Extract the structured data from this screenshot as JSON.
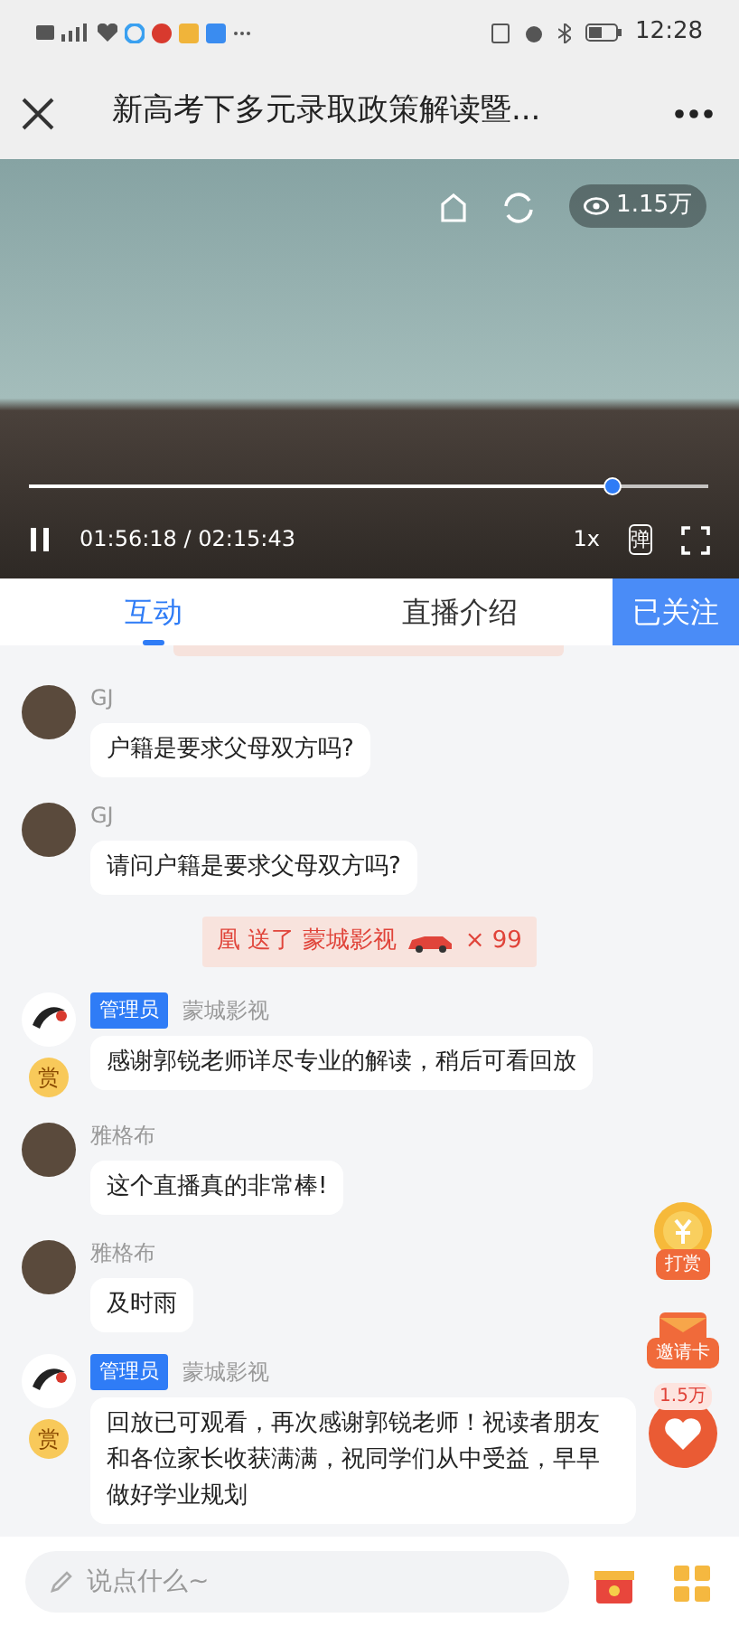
{
  "status_bar": {
    "time": "12:28"
  },
  "header": {
    "title": "新高考下多元录取政策解读暨..."
  },
  "video": {
    "views": "1.15万",
    "progress": {
      "level": 0.86
    },
    "paused": false,
    "time": "01:56:18 / 02:15:43",
    "speed": "1x",
    "danmaku": "弹"
  },
  "tabs": [
    {
      "label": "互动",
      "selected": true
    },
    {
      "label": "直播介绍",
      "selected": false
    }
  ],
  "follow_button": {
    "label": "已关注",
    "followed": true
  },
  "messages": [
    {
      "kind": "user",
      "name": "GJ",
      "text": "户籍是要求父母双方吗?"
    },
    {
      "kind": "user",
      "name": "GJ",
      "text": "请问户籍是要求父母双方吗?"
    },
    {
      "kind": "gift",
      "text": "凰 送了 蒙城影视",
      "count": "× 99"
    },
    {
      "kind": "admin",
      "badge": "管理员",
      "name": "蒙城影视",
      "reward": "赏",
      "text": "感谢郭锐老师详尽专业的解读，稍后可看回放"
    },
    {
      "kind": "user",
      "name": "雅格布",
      "text": "这个直播真的非常棒!"
    },
    {
      "kind": "user",
      "name": "雅格布",
      "text": "及时雨"
    },
    {
      "kind": "admin",
      "badge": "管理员",
      "name": "蒙城影视",
      "reward": "赏",
      "text": "回放已可观看，再次感谢郭锐老师！祝读者朋友和各位家长收获满满，祝同学们从中受益，早早做好学业规划"
    }
  ],
  "floating": {
    "tip_label": "打赏",
    "invite_label": "邀请卡",
    "likes": "1.5万"
  },
  "input": {
    "placeholder": "说点什么~"
  }
}
